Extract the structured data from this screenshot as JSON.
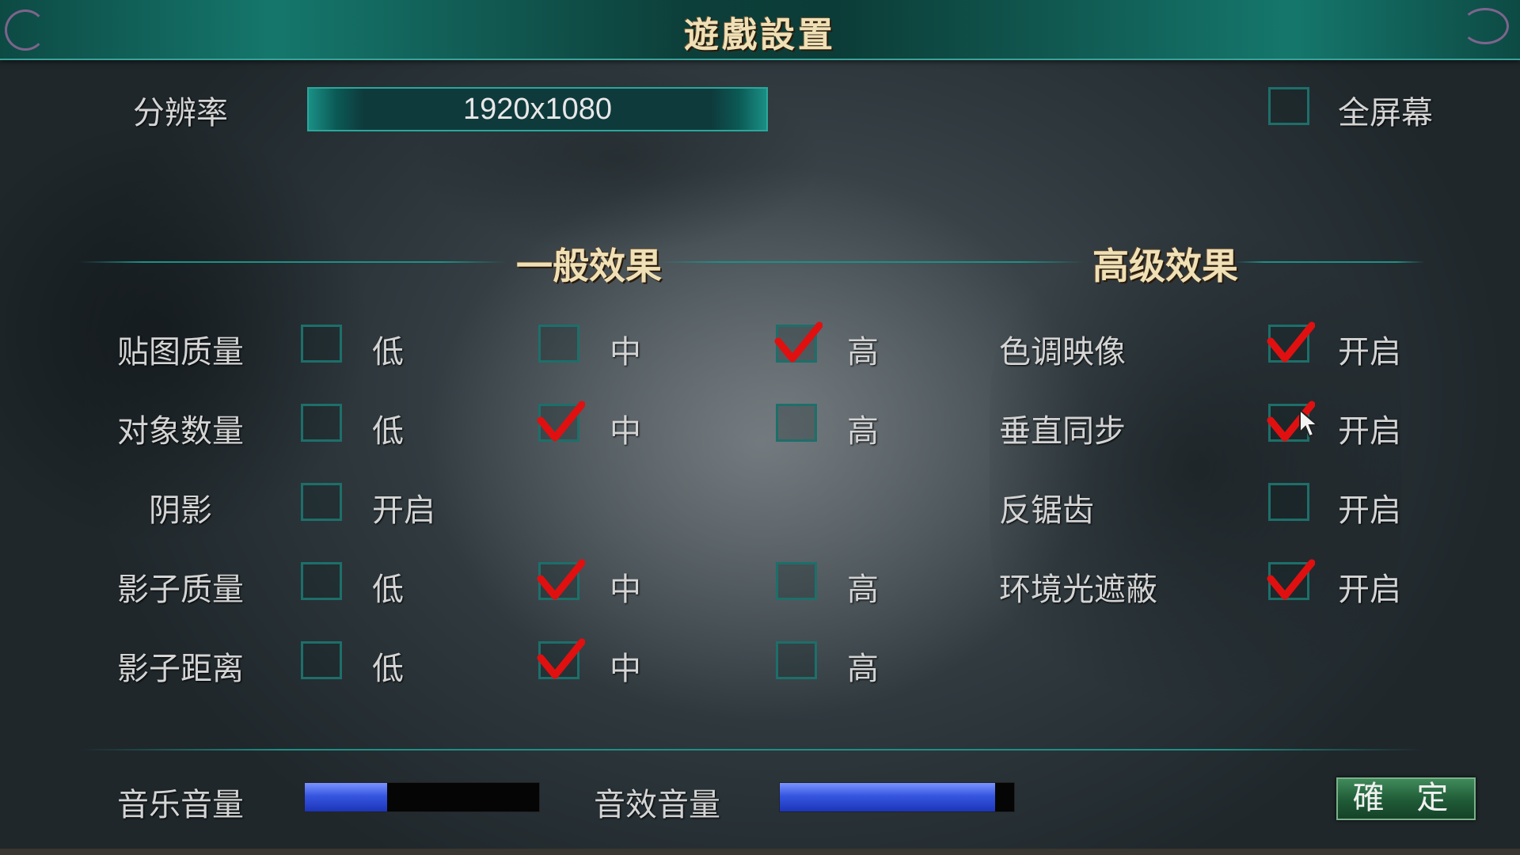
{
  "window": {
    "title": "遊戲設置"
  },
  "resolution": {
    "label": "分辨率",
    "value": "1920x1080"
  },
  "fullscreen": {
    "label": "全屏幕",
    "checked": false
  },
  "sections": {
    "general": "一般效果",
    "advanced": "高级效果"
  },
  "general": [
    {
      "label": "贴图质量",
      "options": [
        {
          "text": "低",
          "checked": false
        },
        {
          "text": "中",
          "checked": false
        },
        {
          "text": "高",
          "checked": true
        }
      ]
    },
    {
      "label": "对象数量",
      "options": [
        {
          "text": "低",
          "checked": false
        },
        {
          "text": "中",
          "checked": true
        },
        {
          "text": "高",
          "checked": false
        }
      ]
    },
    {
      "label": "阴影",
      "options": [
        {
          "text": "开启",
          "checked": false
        }
      ]
    },
    {
      "label": "影子质量",
      "options": [
        {
          "text": "低",
          "checked": false
        },
        {
          "text": "中",
          "checked": true
        },
        {
          "text": "高",
          "checked": false
        }
      ]
    },
    {
      "label": "影子距离",
      "options": [
        {
          "text": "低",
          "checked": false
        },
        {
          "text": "中",
          "checked": true
        },
        {
          "text": "高",
          "checked": false
        }
      ]
    }
  ],
  "advanced": [
    {
      "label": "色调映像",
      "option": "开启",
      "checked": true
    },
    {
      "label": "垂直同步",
      "option": "开启",
      "checked": true
    },
    {
      "label": "反锯齿",
      "option": "开启",
      "checked": false
    },
    {
      "label": "环境光遮蔽",
      "option": "开启",
      "checked": true
    }
  ],
  "volume": {
    "music": {
      "label": "音乐音量",
      "level": 0.35
    },
    "sfx": {
      "label": "音效音量",
      "level": 0.92
    }
  },
  "confirm_button": "確 定",
  "colors": {
    "accent": "#1d6f6a",
    "check": "#e01010",
    "title_gold": "#efe0b6",
    "volume_fill": "#3656e0",
    "button_green": "#1f5a36"
  },
  "icons": {
    "check": "red-check-icon",
    "cursor": "mouse-cursor-icon"
  }
}
